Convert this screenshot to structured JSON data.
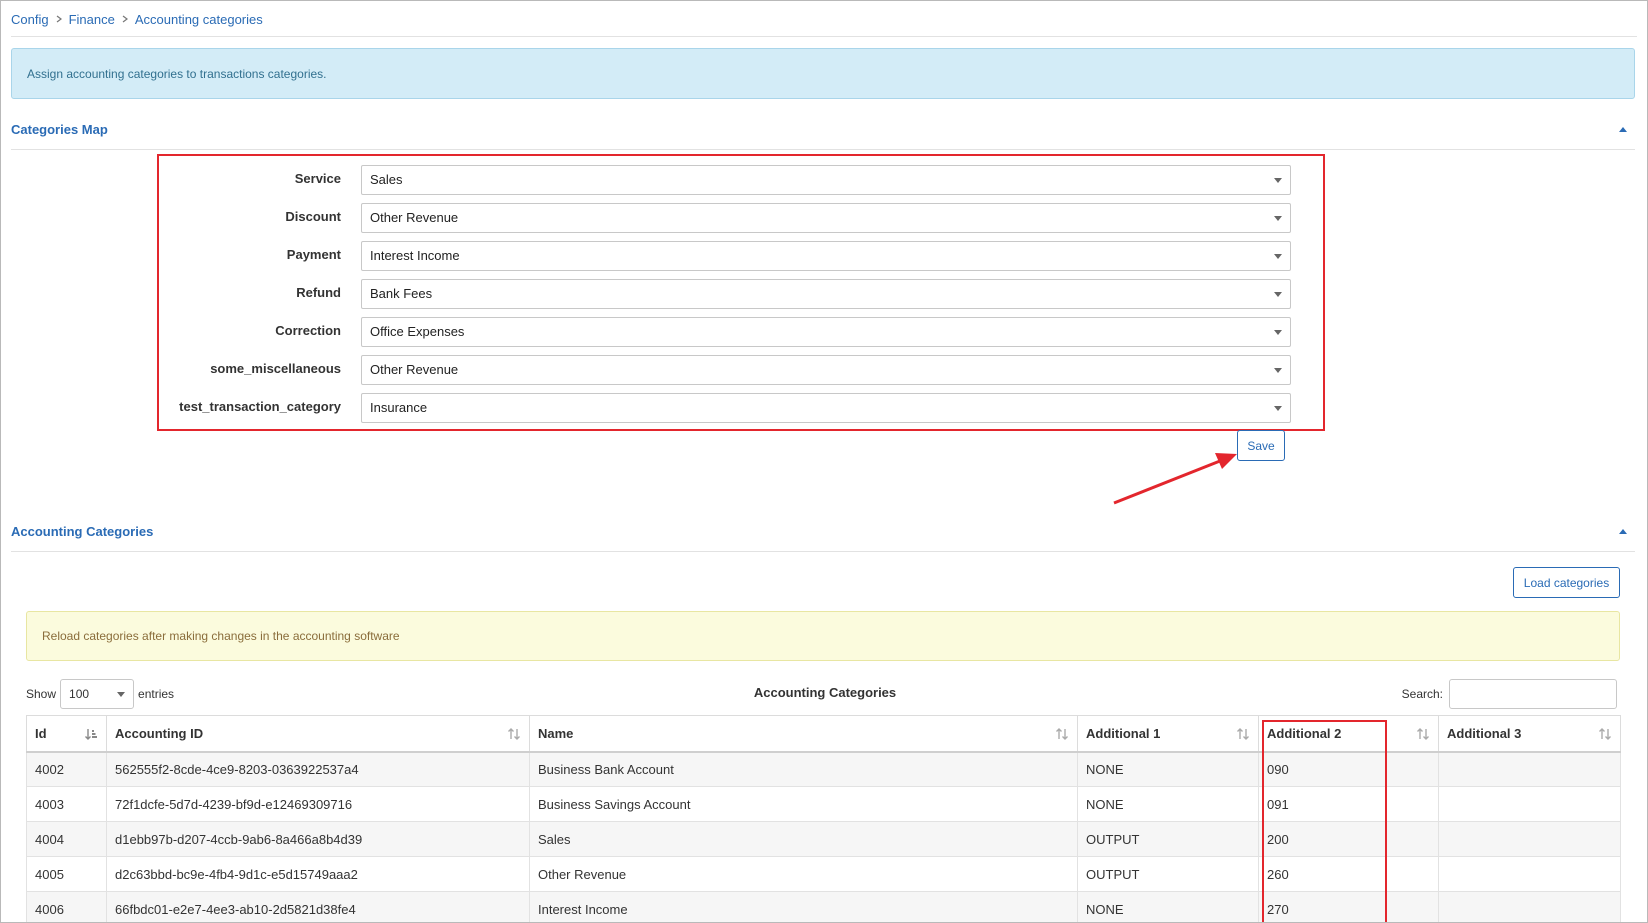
{
  "breadcrumb": [
    "Config",
    "Finance",
    "Accounting categories"
  ],
  "info_alert": "Assign accounting categories to transactions categories.",
  "categories_map": {
    "title": "Categories Map",
    "rows": [
      {
        "label": "Service",
        "value": "Sales"
      },
      {
        "label": "Discount",
        "value": "Other Revenue"
      },
      {
        "label": "Payment",
        "value": "Interest Income"
      },
      {
        "label": "Refund",
        "value": "Bank Fees"
      },
      {
        "label": "Correction",
        "value": "Office Expenses"
      },
      {
        "label": "some_miscellaneous",
        "value": "Other Revenue"
      },
      {
        "label": "test_transaction_category",
        "value": "Insurance"
      }
    ],
    "save_label": "Save"
  },
  "accounting_categories": {
    "title": "Accounting Categories",
    "load_button": "Load categories",
    "warning": "Reload categories after making changes in the accounting software",
    "show_label": "Show",
    "entries_value": "100",
    "entries_label": "entries",
    "caption": "Accounting Categories",
    "search_label": "Search:",
    "columns": [
      "Id",
      "Accounting ID",
      "Name",
      "Additional 1",
      "Additional 2",
      "Additional 3"
    ],
    "rows": [
      {
        "id": "4002",
        "accounting_id": "562555f2-8cde-4ce9-8203-0363922537a4",
        "name": "Business Bank Account",
        "add1": "NONE",
        "add2": "090",
        "add3": ""
      },
      {
        "id": "4003",
        "accounting_id": "72f1dcfe-5d7d-4239-bf9d-e12469309716",
        "name": "Business Savings Account",
        "add1": "NONE",
        "add2": "091",
        "add3": ""
      },
      {
        "id": "4004",
        "accounting_id": "d1ebb97b-d207-4ccb-9ab6-8a466a8b4d39",
        "name": "Sales",
        "add1": "OUTPUT",
        "add2": "200",
        "add3": ""
      },
      {
        "id": "4005",
        "accounting_id": "d2c63bbd-bc9e-4fb4-9d1c-e5d15749aaa2",
        "name": "Other Revenue",
        "add1": "OUTPUT",
        "add2": "260",
        "add3": ""
      },
      {
        "id": "4006",
        "accounting_id": "66fbdc01-e2e7-4ee3-ab10-2d5821d38fe4",
        "name": "Interest Income",
        "add1": "NONE",
        "add2": "270",
        "add3": ""
      }
    ]
  },
  "colors": {
    "link": "#2a6bb5",
    "annotation_red": "#e3262d",
    "info_bg": "#d3ecf7",
    "warning_bg": "#fbfbdd"
  }
}
